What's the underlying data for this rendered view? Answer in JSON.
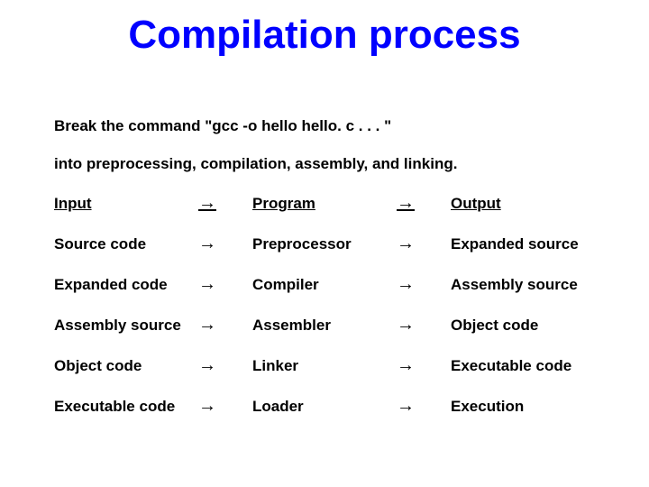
{
  "title": "Compilation process",
  "intro1": "Break the command \"gcc -o hello hello. c . . . \"",
  "intro2": "into preprocessing, compilation, assembly, and linking.",
  "arrow": "→",
  "headers": {
    "input": "Input",
    "program": "Program",
    "output": "Output"
  },
  "rows": [
    {
      "input": "Source code",
      "program": "Preprocessor",
      "output": "Expanded source"
    },
    {
      "input": "Expanded code",
      "program": "Compiler",
      "output": "Assembly source"
    },
    {
      "input": "Assembly source",
      "program": "Assembler",
      "output": "Object code"
    },
    {
      "input": "Object code",
      "program": "Linker",
      "output": "Executable code"
    },
    {
      "input": "Executable code",
      "program": "Loader",
      "output": "Execution"
    }
  ]
}
